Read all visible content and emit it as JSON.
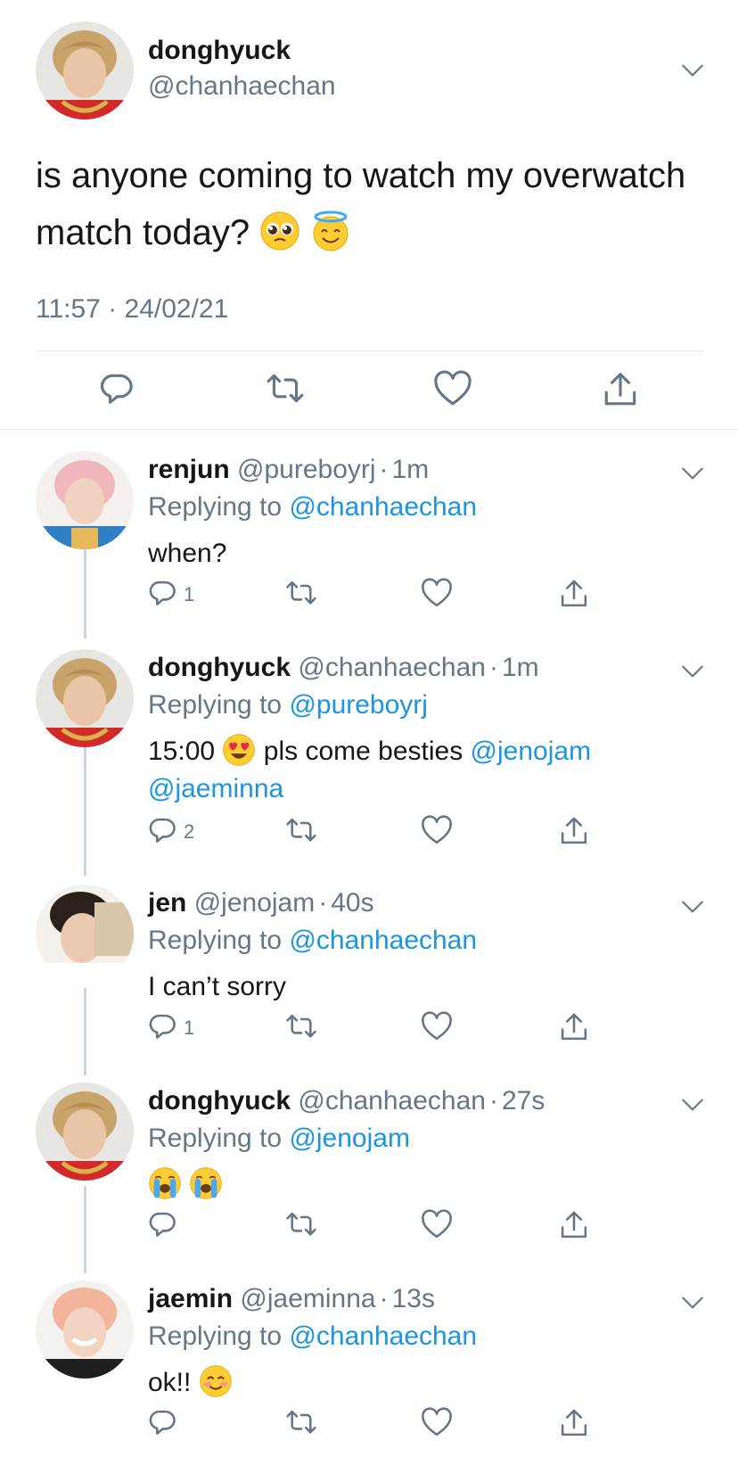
{
  "main_tweet": {
    "name": "donghyuck",
    "handle": "@chanhaechan",
    "text": "is anyone coming to watch my overwatch match today?",
    "emojis": [
      "pleading-face",
      "smiling-face-with-halo"
    ],
    "timestamp": "11:57 · 24/02/21"
  },
  "replies": [
    {
      "name": "renjun",
      "handle": "@pureboyrj",
      "time": "1m",
      "replying_prefix": "Replying to",
      "replying_to": "@chanhaechan",
      "text": "when?",
      "reply_count": "1"
    },
    {
      "name": "donghyuck",
      "handle": "@chanhaechan",
      "time": "1m",
      "replying_prefix": "Replying to",
      "replying_to": "@pureboyrj",
      "text_before": "15:00",
      "text_after": "pls come besties",
      "mention_1": "@jenojam",
      "mention_2": "@jaeminna",
      "reply_count": "2"
    },
    {
      "name": "jen",
      "handle": "@jenojam",
      "time": "40s",
      "replying_prefix": "Replying to",
      "replying_to": "@chanhaechan",
      "text": "I can’t sorry",
      "reply_count": "1"
    },
    {
      "name": "donghyuck",
      "handle": "@chanhaechan",
      "time": "27s",
      "replying_prefix": "Replying to",
      "replying_to": "@jenojam",
      "emojis": [
        "loudly-crying-face",
        "loudly-crying-face"
      ]
    },
    {
      "name": "jaemin",
      "handle": "@jaeminna",
      "time": "13s",
      "replying_prefix": "Replying to",
      "replying_to": "@chanhaechan",
      "text": "ok!!",
      "emojis": [
        "smiling-face-with-smiling-eyes"
      ]
    }
  ],
  "ui": {
    "dot": "·",
    "accent_color": "#1b95e0",
    "muted_color": "#657786",
    "icons": [
      "reply-icon",
      "retweet-icon",
      "like-icon",
      "share-icon",
      "chevron-down-icon"
    ]
  }
}
